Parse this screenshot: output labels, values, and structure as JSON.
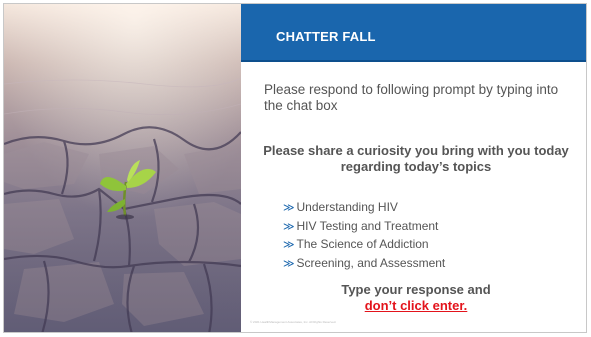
{
  "header": {
    "title": "CHATTER FALL"
  },
  "instruction": "Please respond to following prompt by typing into the chat box",
  "question": "Please share a curiosity you bring with you today regarding today’s topics",
  "topics": [
    {
      "marker": "≫",
      "label": "Understanding HIV"
    },
    {
      "marker": "≫",
      "label": "HIV Testing and Treatment"
    },
    {
      "marker": "≫",
      "label": "The Science of Addiction"
    },
    {
      "marker": "≫",
      "label": "Screening, and Assessment"
    }
  ],
  "cta": {
    "line1": "Type your response and",
    "line2": "don’t click enter."
  },
  "footer": "© 2021 HealthManagement Associates, Inc. All Rights Reserved.",
  "colors": {
    "header_bg": "#1a66ad",
    "body_text": "#555555",
    "warning": "#e3131b"
  },
  "image": {
    "icon": "seedling-in-cracked-ground-photo"
  }
}
